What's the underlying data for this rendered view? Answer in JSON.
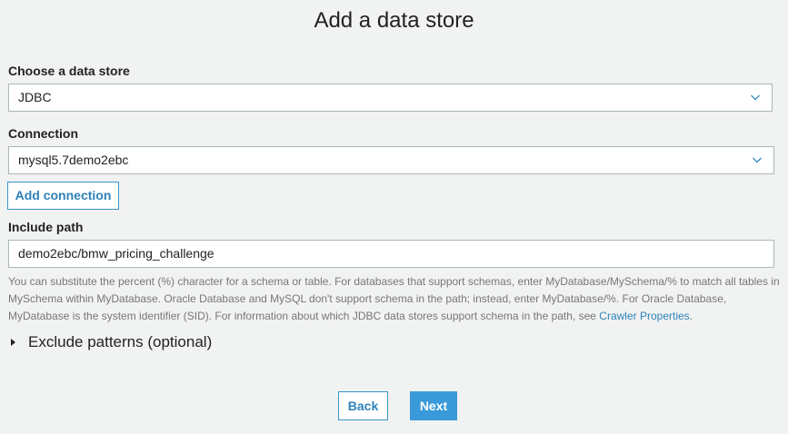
{
  "page": {
    "title": "Add a data store"
  },
  "data_store": {
    "label": "Choose a data store",
    "value": "JDBC"
  },
  "connection": {
    "label": "Connection",
    "value": "mysql5.7demo2ebc",
    "add_button": "Add connection"
  },
  "include_path": {
    "label": "Include path",
    "value": "demo2ebc/bmw_pricing_challenge",
    "help_text": "You can substitute the percent (%) character for a schema or table. For databases that support schemas, enter MyDatabase/MySchema/% to match all tables in MySchema within MyDatabase. Oracle Database and MySQL don't support schema in the path; instead, enter MyDatabase/%. For Oracle Database, MyDatabase is the system identifier (SID). For information about which JDBC data stores support schema in the path, see ",
    "help_link": "Crawler Properties",
    "help_suffix": "."
  },
  "exclude": {
    "label": "Exclude patterns (optional)",
    "icon": "caret-right-icon"
  },
  "footer": {
    "back_label": "Back",
    "next_label": "Next"
  },
  "colors": {
    "background": "#f1f2f2",
    "accent": "#3a9ad9",
    "link": "#2e82b9"
  }
}
